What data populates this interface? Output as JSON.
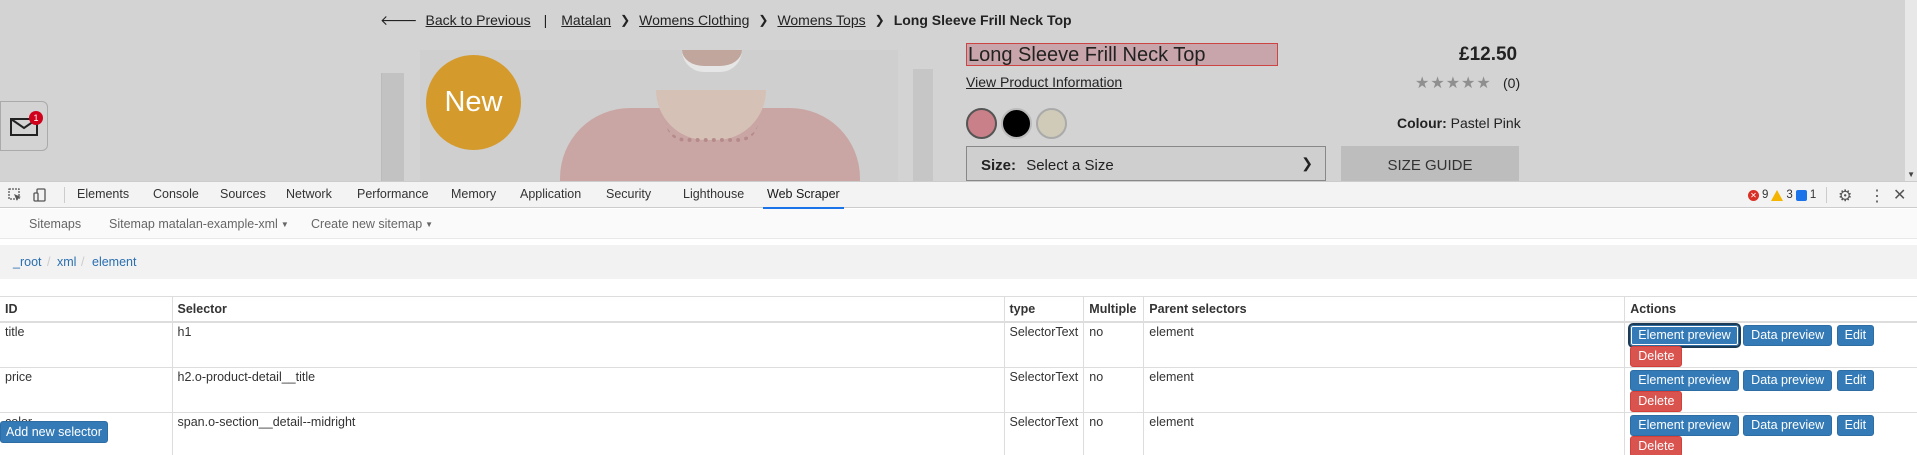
{
  "page": {
    "breadcrumb": {
      "back": "Back to Previous",
      "pipe": "|",
      "items": [
        "Matalan",
        "Womens Clothing",
        "Womens Tops"
      ],
      "current": "Long Sleeve Frill Neck Top"
    },
    "badge": "New",
    "product": {
      "title": "Long Sleeve Frill Neck Top",
      "price": "£12.50",
      "view_info": "View Product Information",
      "stars": "★★★★★",
      "rating_count": "(0)",
      "colour_label": "Colour:",
      "colour_value": "Pastel Pink",
      "swatches": [
        "#c98088",
        "#000000",
        "#cfcbb8"
      ],
      "size_label": "Size:",
      "size_placeholder": "Select a Size",
      "size_guide": "SIZE GUIDE"
    },
    "mail_badge": "1"
  },
  "devtools": {
    "tabs": [
      "Elements",
      "Console",
      "Sources",
      "Network",
      "Performance",
      "Memory",
      "Application",
      "Security",
      "Lighthouse",
      "Web Scraper"
    ],
    "active_tab": "Web Scraper",
    "status": {
      "errors": "9",
      "warnings": "3",
      "info": "1"
    },
    "scraper_nav": {
      "sitemaps": "Sitemaps",
      "sitemap": "Sitemap matalan-example-xml",
      "create": "Create new sitemap"
    },
    "path": [
      "_root",
      "xml",
      "element"
    ],
    "table": {
      "headers": [
        "ID",
        "Selector",
        "type",
        "Multiple",
        "Parent selectors",
        "Actions"
      ],
      "rows": [
        {
          "id": "title",
          "selector": "h1",
          "type": "SelectorText",
          "multiple": "no",
          "parent": "element"
        },
        {
          "id": "price",
          "selector": "h2.o-product-detail__title",
          "type": "SelectorText",
          "multiple": "no",
          "parent": "element"
        },
        {
          "id": "color",
          "selector": "span.o-section__detail--midright",
          "type": "SelectorText",
          "multiple": "no",
          "parent": "element"
        }
      ],
      "actions": [
        "Element preview",
        "Data preview",
        "Edit",
        "Delete"
      ]
    },
    "add_selector": "Add new selector",
    "colors": {
      "accent": "#337ab7",
      "danger": "#d9534f",
      "active_tab": "#1a73e8"
    }
  }
}
